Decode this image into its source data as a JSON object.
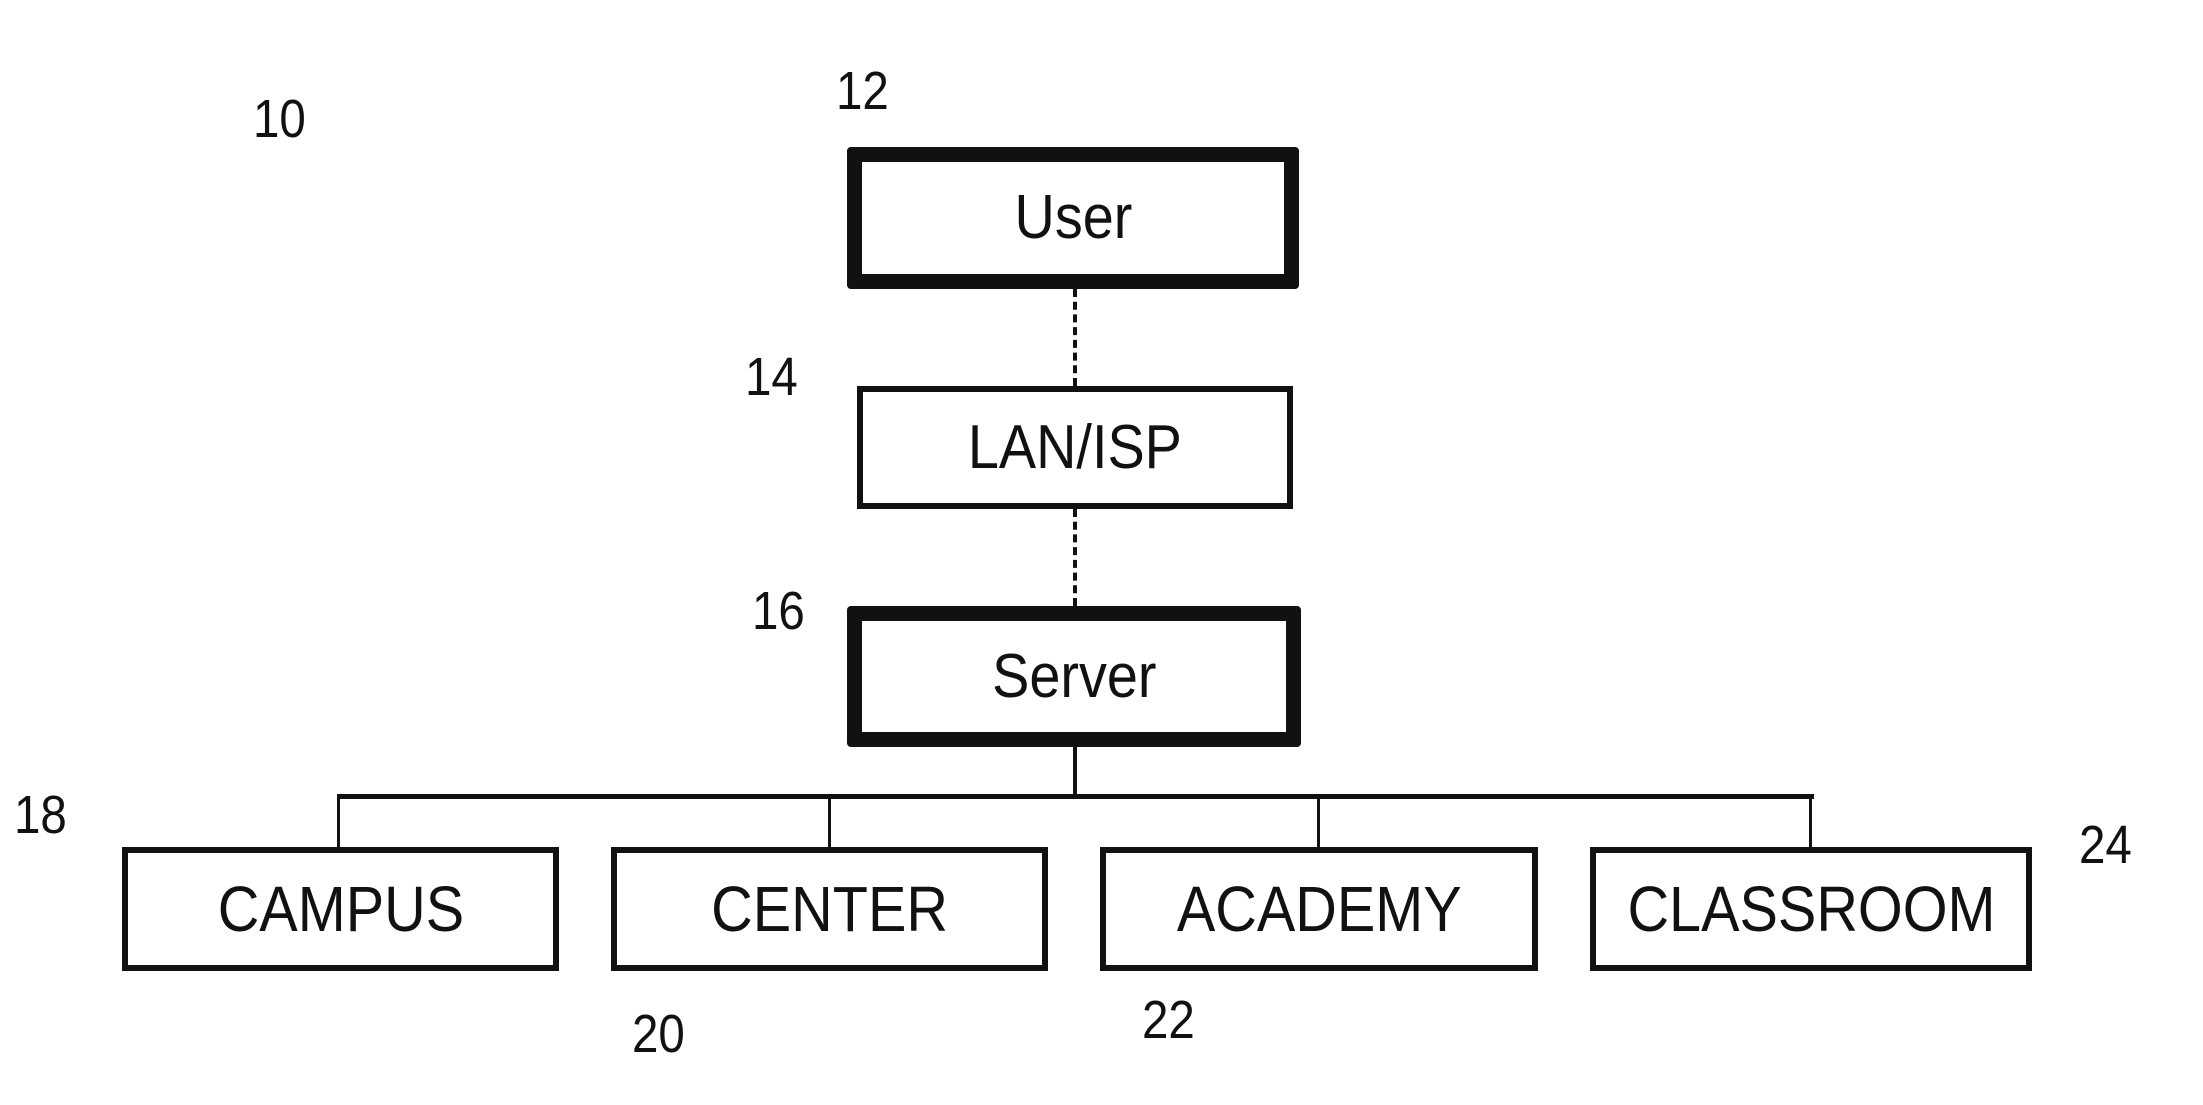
{
  "figure": {
    "reference_numeral": "10",
    "nodes": {
      "user": {
        "ref": "12",
        "label": "User"
      },
      "lan_isp": {
        "ref": "14",
        "label": "LAN/ISP"
      },
      "server": {
        "ref": "16",
        "label": "Server"
      },
      "campus": {
        "ref": "18",
        "label": "CAMPUS"
      },
      "center": {
        "ref": "20",
        "label": "CENTER"
      },
      "academy": {
        "ref": "22",
        "label": "ACADEMY"
      },
      "classroom": {
        "ref": "24",
        "label": "CLASSROOM"
      }
    },
    "connections": [
      {
        "from": "User",
        "to": "LAN/ISP",
        "style": "dashed"
      },
      {
        "from": "LAN/ISP",
        "to": "Server",
        "style": "dashed"
      },
      {
        "from": "Server",
        "to": "CAMPUS",
        "style": "solid"
      },
      {
        "from": "Server",
        "to": "CENTER",
        "style": "solid"
      },
      {
        "from": "Server",
        "to": "ACADEMY",
        "style": "solid"
      },
      {
        "from": "Server",
        "to": "CLASSROOM",
        "style": "solid"
      }
    ]
  }
}
